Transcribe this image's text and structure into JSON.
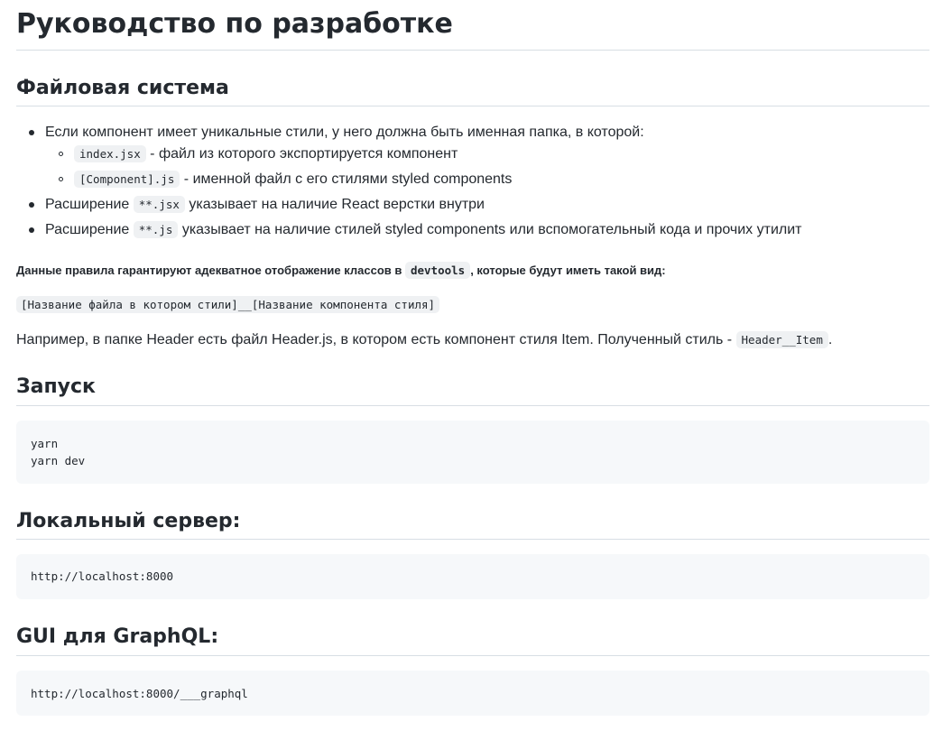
{
  "title": "Руководство по разработке",
  "fs": {
    "heading": "Файловая система",
    "item1": "Если компонент имеет уникальные стили, у него должна быть именная папка, в которой:",
    "sub1_code": "index.jsx",
    "sub1_text": " - файл из которого экспортируется компонент",
    "sub2_code": "[Component].js",
    "sub2_text": " - именной файл с его стилями styled components",
    "item2_pre": "Расширение ",
    "item2_code": "**.jsx",
    "item2_post": " указывает на наличие React верстки внутри",
    "item3_pre": "Расширение ",
    "item3_code": "**.js",
    "item3_post": " указывает на наличие стилей styled components или вспомогательный кода и прочих утилит",
    "note_pre": "Данные правила гарантируют адекватное отображение классов в ",
    "note_code": "devtools",
    "note_post": ", которые будут иметь такой вид:",
    "pattern_code": "[Название файла в котором стили]__[Название компонента стиля]",
    "example_pre": "Например, в папке Header есть файл Header.js, в котором есть компонент стиля Item. Полученный стиль - ",
    "example_code": "Header__Item",
    "example_post": "."
  },
  "launch": {
    "heading": "Запуск",
    "code": "yarn\nyarn dev"
  },
  "local": {
    "heading": "Локальный сервер:",
    "code": "http://localhost:8000"
  },
  "graphql": {
    "heading": "GUI для GraphQL:",
    "code": "http://localhost:8000/___graphql"
  }
}
